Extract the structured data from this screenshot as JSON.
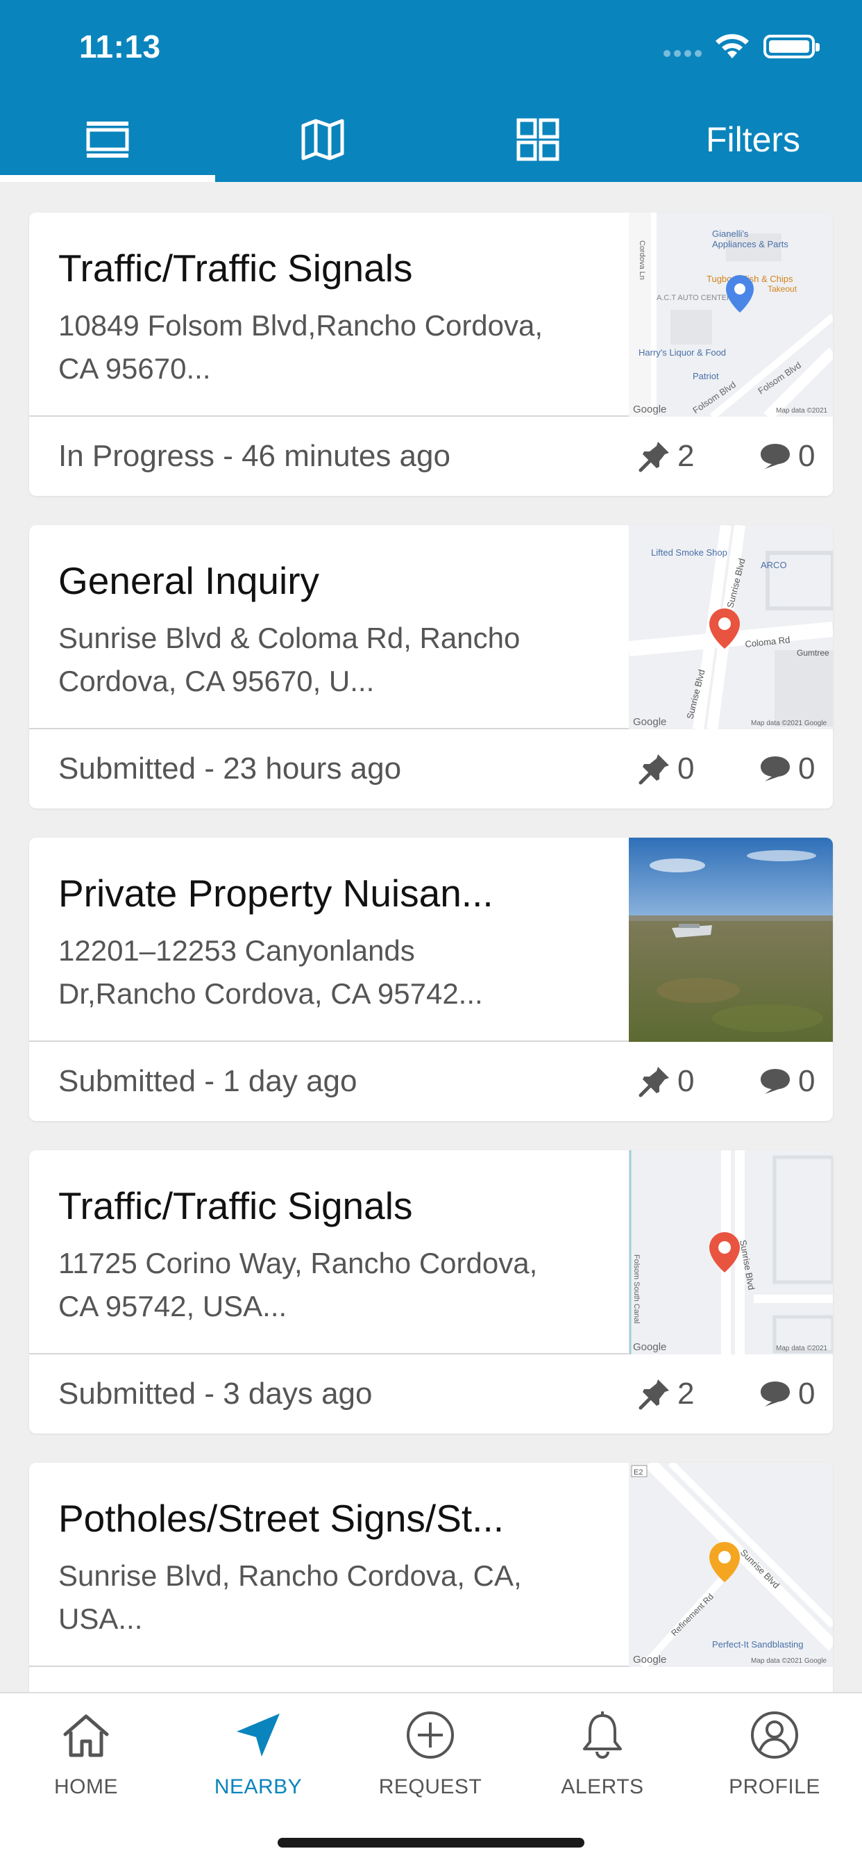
{
  "status_bar": {
    "time": "11:13"
  },
  "top_tabs": {
    "filters_label": "Filters"
  },
  "colors": {
    "brand": "#0a84bd",
    "pin_red": "#e8543f",
    "pin_blue": "#4a86e8",
    "pin_orange": "#f4a621"
  },
  "cards": [
    {
      "title": "Traffic/Traffic Signals",
      "address": "10849 Folsom Blvd,Rancho Cordova, CA 95670...",
      "status": "In Progress - 46 minutes ago",
      "pins": "2",
      "comments": "0",
      "thumb": "map",
      "map_labels": {
        "a": "Gianelli's",
        "b": "Appliances & Parts",
        "c": "Tugboat Fish & Chips",
        "d": "Takeout",
        "e": "A.C.T AUTO CENTER",
        "f": "Harry's Liquor & Food",
        "g": "Patriot",
        "h": "Folsom Blvd",
        "i": "Folsom Blvd",
        "j": "Cordova Ln",
        "google": "Google",
        "mapdata": "Map data ©2021"
      }
    },
    {
      "title": "General Inquiry",
      "address": "Sunrise Blvd & Coloma Rd, Rancho Cordova, CA 95670, U...",
      "status": "Submitted - 23 hours ago",
      "pins": "0",
      "comments": "0",
      "thumb": "map",
      "map_labels": {
        "a": "Lifted Smoke Shop",
        "b": "ARCO",
        "c": "Coloma Rd",
        "d": "Gumtree",
        "e": "Sunrise Blvd",
        "f": "Sunrise Blvd",
        "google": "Google",
        "mapdata": "Map data ©2021 Google"
      }
    },
    {
      "title": "Private Property Nuisan...",
      "address": "12201–12253 Canyonlands Dr,Rancho Cordova, CA 95742...",
      "status": "Submitted - 1 day ago",
      "pins": "0",
      "comments": "0",
      "thumb": "photo"
    },
    {
      "title": "Traffic/Traffic Signals",
      "address": "11725 Corino Way, Rancho Cordova, CA 95742, USA...",
      "status": "Submitted - 3 days ago",
      "pins": "2",
      "comments": "0",
      "thumb": "map",
      "map_labels": {
        "a": "Folsom South Canal",
        "b": "Sunrise Blvd",
        "google": "Google",
        "mapdata": "Map data ©2021"
      }
    },
    {
      "title": "Potholes/Street Signs/St...",
      "address": "Sunrise Blvd, Rancho Cordova, CA, USA...",
      "status": "",
      "pins": "",
      "comments": "",
      "thumb": "map",
      "map_labels": {
        "a": "E2",
        "b": "Sunrise Blvd",
        "c": "Refinement Rd",
        "d": "Perfect-It Sandblasting",
        "google": "Google",
        "mapdata": "Map data ©2021 Google"
      }
    }
  ],
  "tabbar": {
    "home": "HOME",
    "nearby": "NEARBY",
    "request": "REQUEST",
    "alerts": "ALERTS",
    "profile": "PROFILE"
  }
}
